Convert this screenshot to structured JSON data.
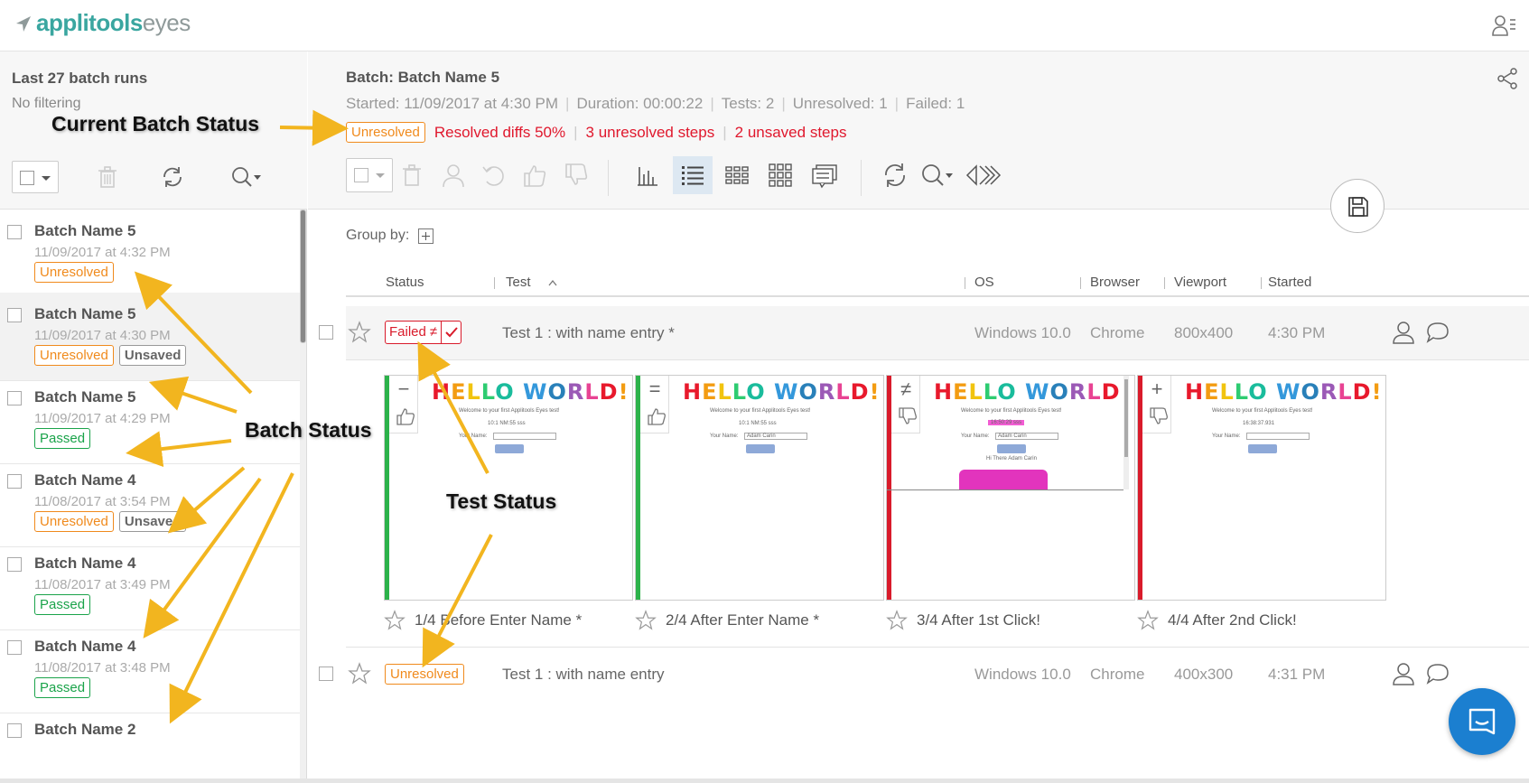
{
  "brand": {
    "name_bold": "applitools",
    "name_light": "eyes",
    "accent": "#3aa6a0"
  },
  "sidebar": {
    "title": "Last 27 batch runs",
    "filter": "No filtering",
    "batches": [
      {
        "name": "Batch Name 5",
        "date": "11/09/2017 at 4:32 PM",
        "badges": [
          "Unresolved"
        ]
      },
      {
        "name": "Batch Name 5",
        "date": "11/09/2017 at 4:30 PM",
        "badges": [
          "Unresolved",
          "Unsaved"
        ]
      },
      {
        "name": "Batch Name 5",
        "date": "11/09/2017 at 4:29 PM",
        "badges": [
          "Passed"
        ]
      },
      {
        "name": "Batch Name 4",
        "date": "11/08/2017 at 3:54 PM",
        "badges": [
          "Unresolved",
          "Unsaved"
        ]
      },
      {
        "name": "Batch Name 4",
        "date": "11/08/2017 at 3:49 PM",
        "badges": [
          "Passed"
        ]
      },
      {
        "name": "Batch Name 4",
        "date": "11/08/2017 at 3:48 PM",
        "badges": [
          "Passed"
        ]
      },
      {
        "name": "Batch Name 2",
        "date": "",
        "badges": []
      }
    ]
  },
  "batch": {
    "title": "Batch: Batch Name 5",
    "started": "Started: 11/09/2017 at 4:30 PM",
    "duration": "Duration: 00:00:22",
    "tests": "Tests: 2",
    "unresolved": "Unresolved: 1",
    "failed": "Failed: 1",
    "status_badge": "Unresolved",
    "resolved_diffs": "Resolved diffs 50%",
    "unresolved_steps": "3 unresolved steps",
    "unsaved_steps": "2 unsaved steps"
  },
  "group_by_label": "Group by:",
  "table": {
    "columns": [
      "Status",
      "Test",
      "OS",
      "Browser",
      "Viewport",
      "Started"
    ],
    "rows": [
      {
        "status": "Failed",
        "test": "Test 1 : with name entry *",
        "os": "Windows 10.0",
        "browser": "Chrome",
        "viewport": "800x400",
        "started": "4:30 PM"
      },
      {
        "status": "Unresolved",
        "test": "Test 1 : with name entry",
        "os": "Windows 10.0",
        "browser": "Chrome",
        "viewport": "400x300",
        "started": "4:31 PM"
      }
    ]
  },
  "steps": [
    {
      "symbol": "−",
      "label": "1/4 Before Enter Name *",
      "status_color": "#2cb24a",
      "time": "10:1 NM:55 sss",
      "name_value": ""
    },
    {
      "symbol": "=",
      "label": "2/4 After Enter Name *",
      "status_color": "#2cb24a",
      "time": "10:1 NM:55 sss",
      "name_value": "Adam Carin"
    },
    {
      "symbol": "≠",
      "label": "3/4 After 1st Click!",
      "status_color": "#d91b2b",
      "time": "16:50:29 sss",
      "name_value": "Adam Carin",
      "greeting": "Hi There Adam Carin"
    },
    {
      "symbol": "+",
      "label": "4/4 After 2nd Click!",
      "status_color": "#d91b2b",
      "time": "16:38:37.931",
      "name_value": ""
    }
  ],
  "mini_page": {
    "hello": "HELLO WORLD!",
    "welcome": "Welcome to your first Applitools Eyes test!",
    "your_name": "Your Name:",
    "click_me": "Click me!"
  },
  "annotations": {
    "current_batch_status": "Current Batch Status",
    "batch_status": "Batch Status",
    "test_status": "Test Status",
    "arrow_color": "#f2b51f"
  }
}
